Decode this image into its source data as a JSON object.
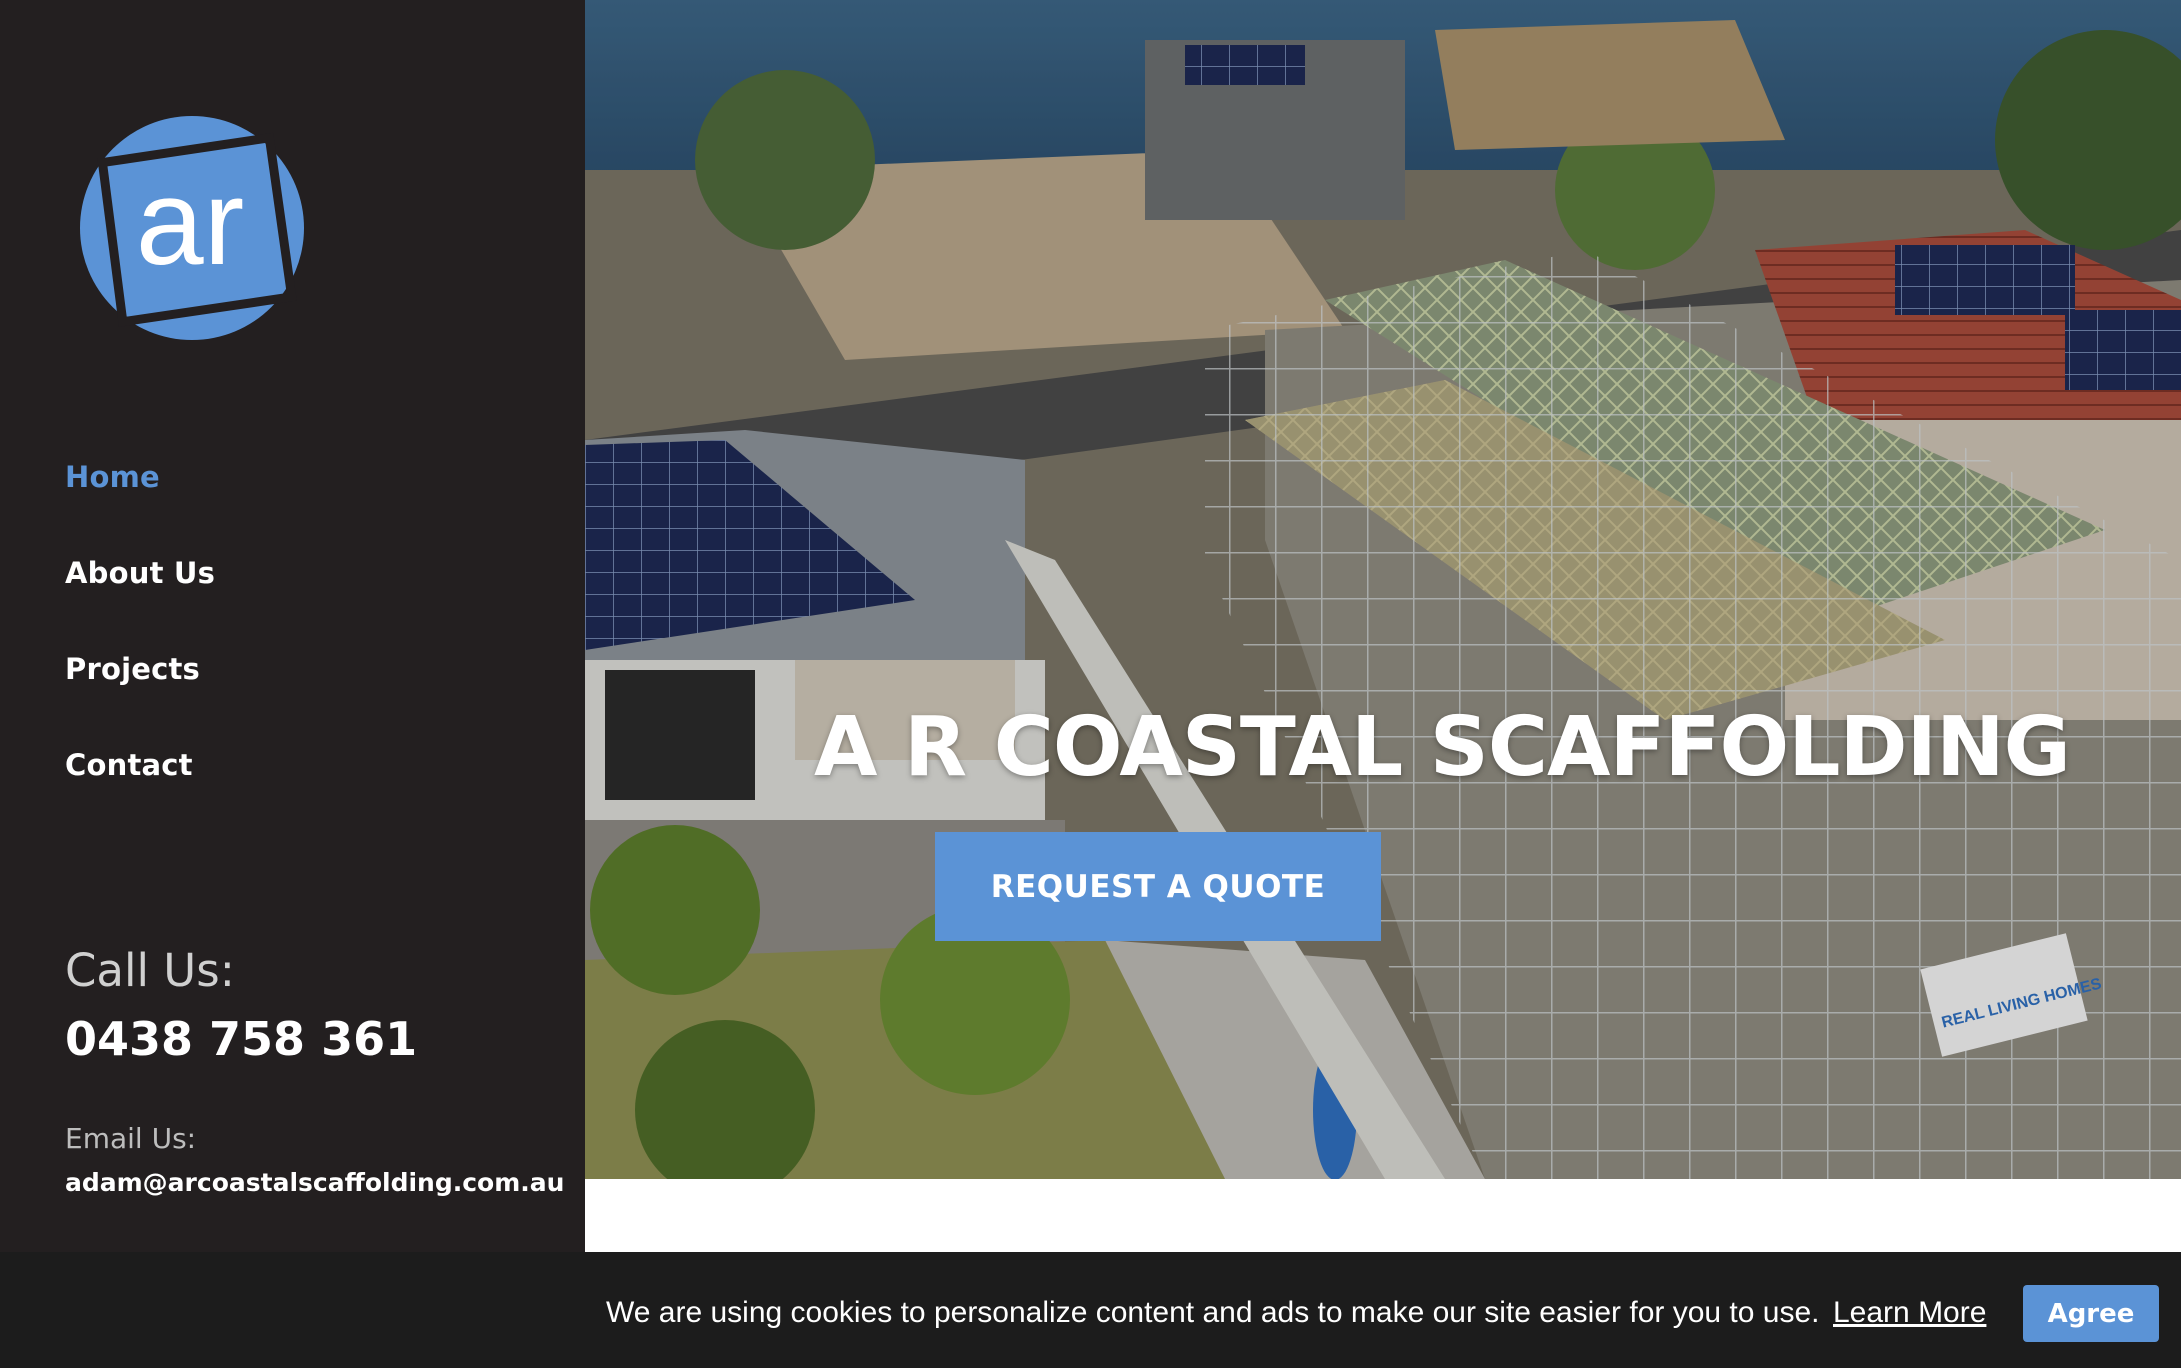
{
  "brand": {
    "logo_text": "ar",
    "accent_color": "#5b93d6",
    "sidebar_color": "#231f20"
  },
  "nav": {
    "items": [
      {
        "label": "Home",
        "active": true
      },
      {
        "label": "About Us",
        "active": false
      },
      {
        "label": "Projects",
        "active": false
      },
      {
        "label": "Contact",
        "active": false
      }
    ]
  },
  "contact": {
    "call_label": "Call Us:",
    "phone": "0438 758 361",
    "email_label": "Email Us:",
    "email": "adam@arcoastalscaffolding.com.au"
  },
  "hero": {
    "title": "A R COASTAL SCAFFOLDING",
    "cta_label": "REQUEST A QUOTE",
    "sign_text": "REAL LIVING HOMES"
  },
  "cookie": {
    "message": "We are using cookies to personalize content and ads to make our site easier for you to use.",
    "learn_more": "Learn More",
    "agree": "Agree"
  }
}
